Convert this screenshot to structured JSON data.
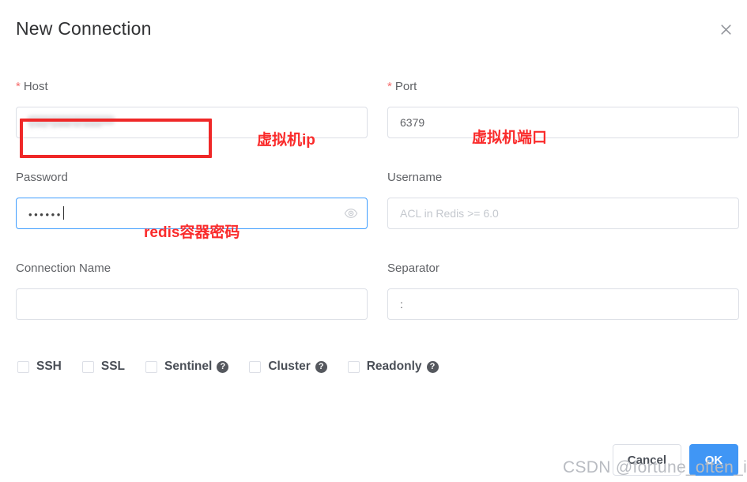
{
  "dialog": {
    "title": "New Connection",
    "close_icon": "close-icon"
  },
  "form": {
    "host": {
      "label": "Host",
      "required_marker": "*",
      "value": "192.168.0.xxx",
      "redacted": true,
      "annotation": "虚拟机ip"
    },
    "port": {
      "label": "Port",
      "required_marker": "*",
      "value": "6379",
      "annotation": "虚拟机端口"
    },
    "password": {
      "label": "Password",
      "value": "••••••",
      "focused": true,
      "annotation": "redis容器密码",
      "reveal_icon": "eye-icon"
    },
    "username": {
      "label": "Username",
      "value": "",
      "placeholder": "ACL in Redis >= 6.0"
    },
    "connection_name": {
      "label": "Connection Name",
      "value": "",
      "placeholder": ""
    },
    "separator": {
      "label": "Separator",
      "value": ":",
      "placeholder": ""
    }
  },
  "options": [
    {
      "label": "SSH",
      "checked": false,
      "help": false,
      "help_glyph": "?"
    },
    {
      "label": "SSL",
      "checked": false,
      "help": false,
      "help_glyph": "?"
    },
    {
      "label": "Sentinel",
      "checked": false,
      "help": true,
      "help_glyph": "?"
    },
    {
      "label": "Cluster",
      "checked": false,
      "help": true,
      "help_glyph": "?"
    },
    {
      "label": "Readonly",
      "checked": false,
      "help": true,
      "help_glyph": "?"
    }
  ],
  "footer": {
    "cancel_label": "Cancel",
    "ok_label": "OK"
  },
  "watermark": "CSDN @fortune_often_in",
  "colors": {
    "accent_blue": "#409eff",
    "ok_button": "#4096f5",
    "annotation_red": "#fa2b2b",
    "required_red": "#f56c6c",
    "border_gray": "#dcdfe6",
    "label_gray": "#606266",
    "watermark_gray": "#b9bcc2"
  }
}
